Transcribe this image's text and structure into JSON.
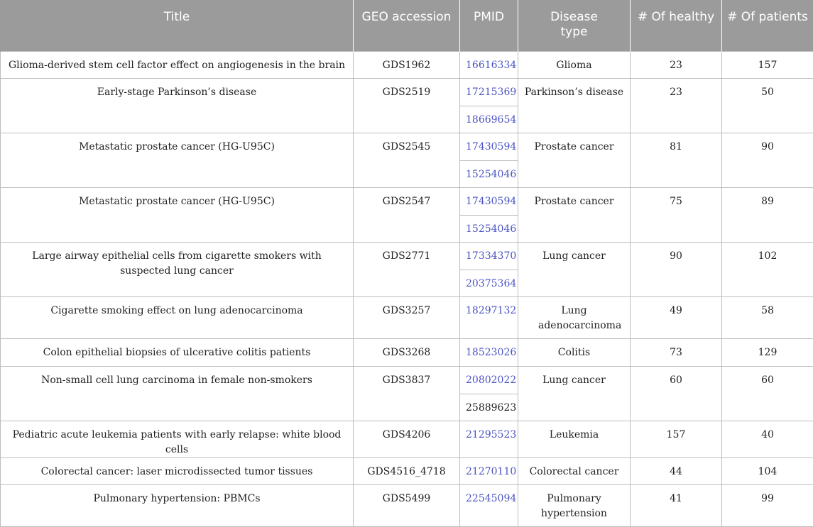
{
  "headers": {
    "title": "Title",
    "geo": "GEO accession",
    "pmid": "PMID",
    "disease": "Disease type",
    "healthy": "# Of healthy",
    "patients": "# Of patients"
  },
  "colors": {
    "header_bg": "#9b9b9b",
    "header_text": "#ffffff",
    "pmid_link": "#4b53c4",
    "grid": "#bdbdbd"
  },
  "rows": [
    {
      "title": "Glioma-derived stem cell factor effect on angiogenesis in the brain",
      "geo": "GDS1962",
      "pmids": [
        "16616334"
      ],
      "disease": "Glioma",
      "healthy": "23",
      "patients": "157"
    },
    {
      "title": "Early-stage Parkinson’s disease",
      "geo": "GDS2519",
      "pmids": [
        "17215369",
        "18669654"
      ],
      "disease": "Parkinson’s disease",
      "healthy": "23",
      "patients": "50"
    },
    {
      "title": "Metastatic prostate cancer (HG-U95C)",
      "geo": "GDS2545",
      "pmids": [
        "17430594",
        "15254046"
      ],
      "disease": "Prostate cancer",
      "healthy": "81",
      "patients": "90"
    },
    {
      "title": "Metastatic prostate cancer (HG-U95C)",
      "geo": "GDS2547",
      "pmids": [
        "17430594",
        "15254046"
      ],
      "disease": "Prostate cancer",
      "healthy": "75",
      "patients": "89"
    },
    {
      "title": "Large airway epithelial cells from cigarette smokers with suspected lung cancer",
      "geo": "GDS2771",
      "pmids": [
        "17334370",
        "20375364"
      ],
      "disease": "Lung cancer",
      "healthy": "90",
      "patients": "102"
    },
    {
      "title": "Cigarette smoking effect on lung adenocarcinoma",
      "geo": "GDS3257",
      "pmids": [
        "18297132"
      ],
      "disease": "Lung adenocarcinoma",
      "healthy": "49",
      "patients": "58"
    },
    {
      "title": "Colon epithelial biopsies of ulcerative colitis patients",
      "geo": "GDS3268",
      "pmids": [
        "18523026"
      ],
      "disease": "Colitis",
      "healthy": "73",
      "patients": "129"
    },
    {
      "title": "Non-small cell lung carcinoma in female non-smokers",
      "geo": "GDS3837",
      "pmids": [
        "20802022",
        "25889623"
      ],
      "disease": "Lung cancer",
      "healthy": "60",
      "patients": "60"
    },
    {
      "title": "Pediatric acute leukemia patients with early relapse: white blood cells",
      "geo": "GDS4206",
      "pmids": [
        "21295523"
      ],
      "disease": "Leukemia",
      "healthy": "157",
      "patients": "40"
    },
    {
      "title": "Colorectal cancer: laser microdissected tumor tissues",
      "geo": "GDS4516_4718",
      "pmids": [
        "21270110"
      ],
      "disease": "Colorectal cancer",
      "healthy": "44",
      "patients": "104"
    },
    {
      "title": "Pulmonary hypertension: PBMCs",
      "geo": "GDS5499",
      "pmids": [
        "22545094"
      ],
      "disease": "Pulmonary hypertension",
      "healthy": "41",
      "patients": "99"
    }
  ]
}
